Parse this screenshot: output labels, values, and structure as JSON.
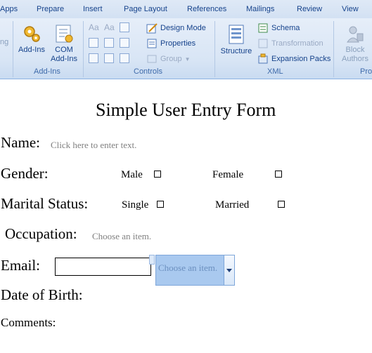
{
  "ribbon": {
    "tabs": [
      "Apps",
      "Prepare",
      "Insert",
      "Page Layout",
      "References",
      "Mailings",
      "Review",
      "View"
    ],
    "partial_left_label": "ng",
    "addins": {
      "addins_label": "Add-Ins",
      "com_label_1": "COM",
      "com_label_2": "Add-Ins",
      "group_label": "Add-Ins"
    },
    "controls": {
      "design_mode": "Design Mode",
      "properties": "Properties",
      "group": "Group",
      "group_label": "Controls"
    },
    "xml": {
      "structure": "Structure",
      "schema": "Schema",
      "transformation": "Transformation",
      "expansion_packs": "Expansion Packs",
      "group_label": "XML"
    },
    "protect": {
      "block_1": "Block",
      "block_2": "Authors",
      "group_label_partial": "Pro"
    }
  },
  "form": {
    "title": "Simple User Entry Form",
    "name_label": "Name:",
    "name_placeholder": "Click here to enter text.",
    "gender_label": "Gender:",
    "male": "Male",
    "female": "Female",
    "marital_label": "Marital Status:",
    "single": "Single",
    "married": "Married",
    "occupation_label": "Occupation:",
    "occupation_placeholder": "Choose an item.",
    "email_label": "Email:",
    "dropdown_placeholder": "Choose an item.",
    "dob_label": "Date of Birth:",
    "comments_label": "Comments:"
  }
}
